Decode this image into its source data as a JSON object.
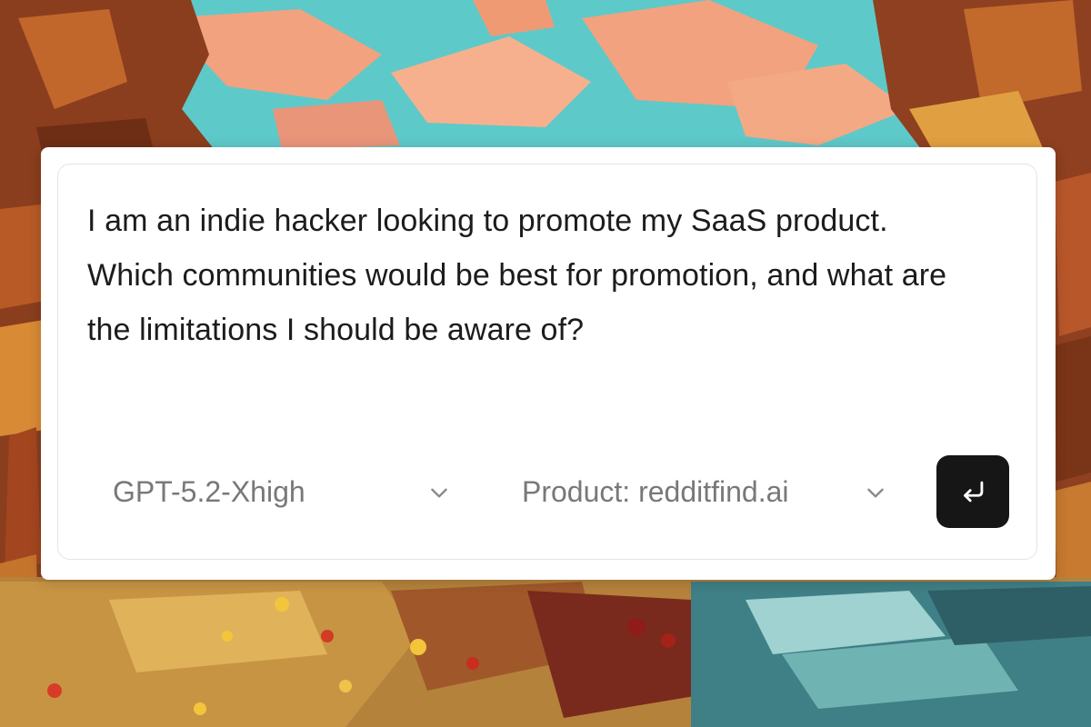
{
  "prompt": {
    "text": "I am an indie hacker looking to promote my SaaS product. Which communities would be best for promotion, and what are the limitations I should be aware of?"
  },
  "model_select": {
    "value": "GPT-5.2-Xhigh",
    "icon": "chevron-down-icon"
  },
  "product_select": {
    "value": "Product: redditfind.ai",
    "icon": "chevron-down-icon"
  },
  "submit": {
    "icon": "enter-return-icon",
    "background": "#161616"
  },
  "colors": {
    "panel_background": "#ffffff",
    "text_primary": "#1c1c1c",
    "text_secondary": "#787878",
    "sky_turquoise": "#5ec9c9",
    "sky_peach": "#f2a27f",
    "rust": "#9b4a22"
  }
}
